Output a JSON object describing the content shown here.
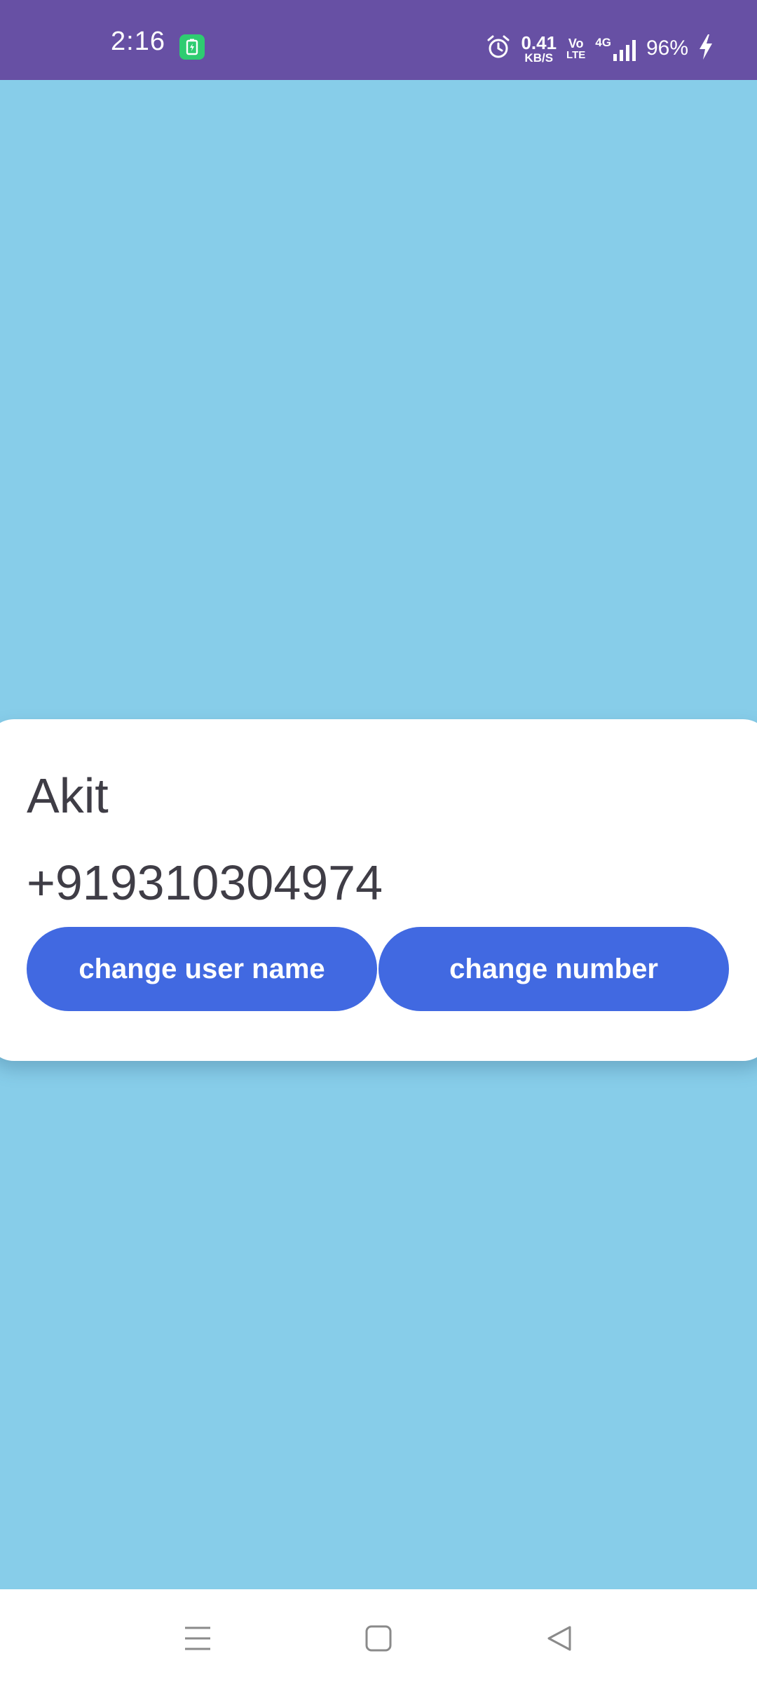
{
  "status_bar": {
    "time": "2:16",
    "net_speed_value": "0.41",
    "net_speed_unit": "KB/S",
    "volte_top": "Vo",
    "volte_bottom": "LTE",
    "network": "4G",
    "battery": "96%",
    "icons": [
      "battery-saver-app-icon",
      "alarm-icon",
      "signal-icon",
      "charging-icon"
    ]
  },
  "profile": {
    "name": "Akit",
    "number": "+919310304974",
    "change_name_label": "change user name",
    "change_number_label": "change number"
  },
  "nav_bar": {
    "icons": [
      "menu-icon",
      "home-icon",
      "back-icon"
    ]
  },
  "colors": {
    "background": "#87CDE9",
    "status_bar": "#6750A4",
    "button": "#4169E1",
    "card": "#FFFFFF",
    "text": "#3F3D46"
  }
}
